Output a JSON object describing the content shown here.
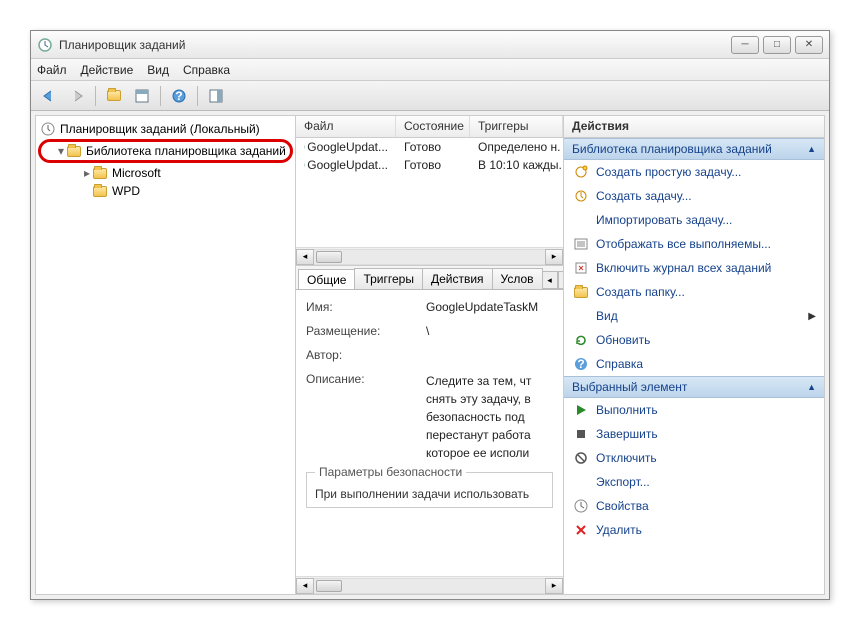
{
  "window": {
    "title": "Планировщик заданий"
  },
  "menu": {
    "file": "Файл",
    "action": "Действие",
    "view": "Вид",
    "help": "Справка"
  },
  "tree": {
    "root": "Планировщик заданий (Локальный)",
    "lib": "Библиотека планировщика заданий",
    "children": [
      "Microsoft",
      "WPD"
    ]
  },
  "tasklist": {
    "cols": {
      "file": "Файл",
      "state": "Состояние",
      "triggers": "Триггеры"
    },
    "rows": [
      {
        "file": "GoogleUpdat...",
        "state": "Готово",
        "triggers": "Определено н."
      },
      {
        "file": "GoogleUpdat...",
        "state": "Готово",
        "triggers": "В 10:10 кажды."
      }
    ]
  },
  "detail": {
    "tabs": {
      "general": "Общие",
      "triggers": "Триггеры",
      "actions": "Действия",
      "conditions": "Услов"
    },
    "name_label": "Имя:",
    "name_value": "GoogleUpdateTaskМ",
    "location_label": "Размещение:",
    "location_value": "\\",
    "author_label": "Автор:",
    "desc_label": "Описание:",
    "desc_value": "Следите за тем, чт снять эту задачу, в безопасность под перестанут работа которое ее исполи",
    "security_group": "Параметры безопасности",
    "security_line": "При выполнении задачи использовать"
  },
  "actions": {
    "header": "Действия",
    "group1": "Библиотека планировщика заданий",
    "items1": [
      "Создать простую задачу...",
      "Создать задачу...",
      "Импортировать задачу...",
      "Отображать все выполняемы...",
      "Включить журнал всех заданий",
      "Создать папку...",
      "Вид",
      "Обновить",
      "Справка"
    ],
    "group2": "Выбранный элемент",
    "items2": [
      "Выполнить",
      "Завершить",
      "Отключить",
      "Экспорт...",
      "Свойства",
      "Удалить"
    ]
  }
}
